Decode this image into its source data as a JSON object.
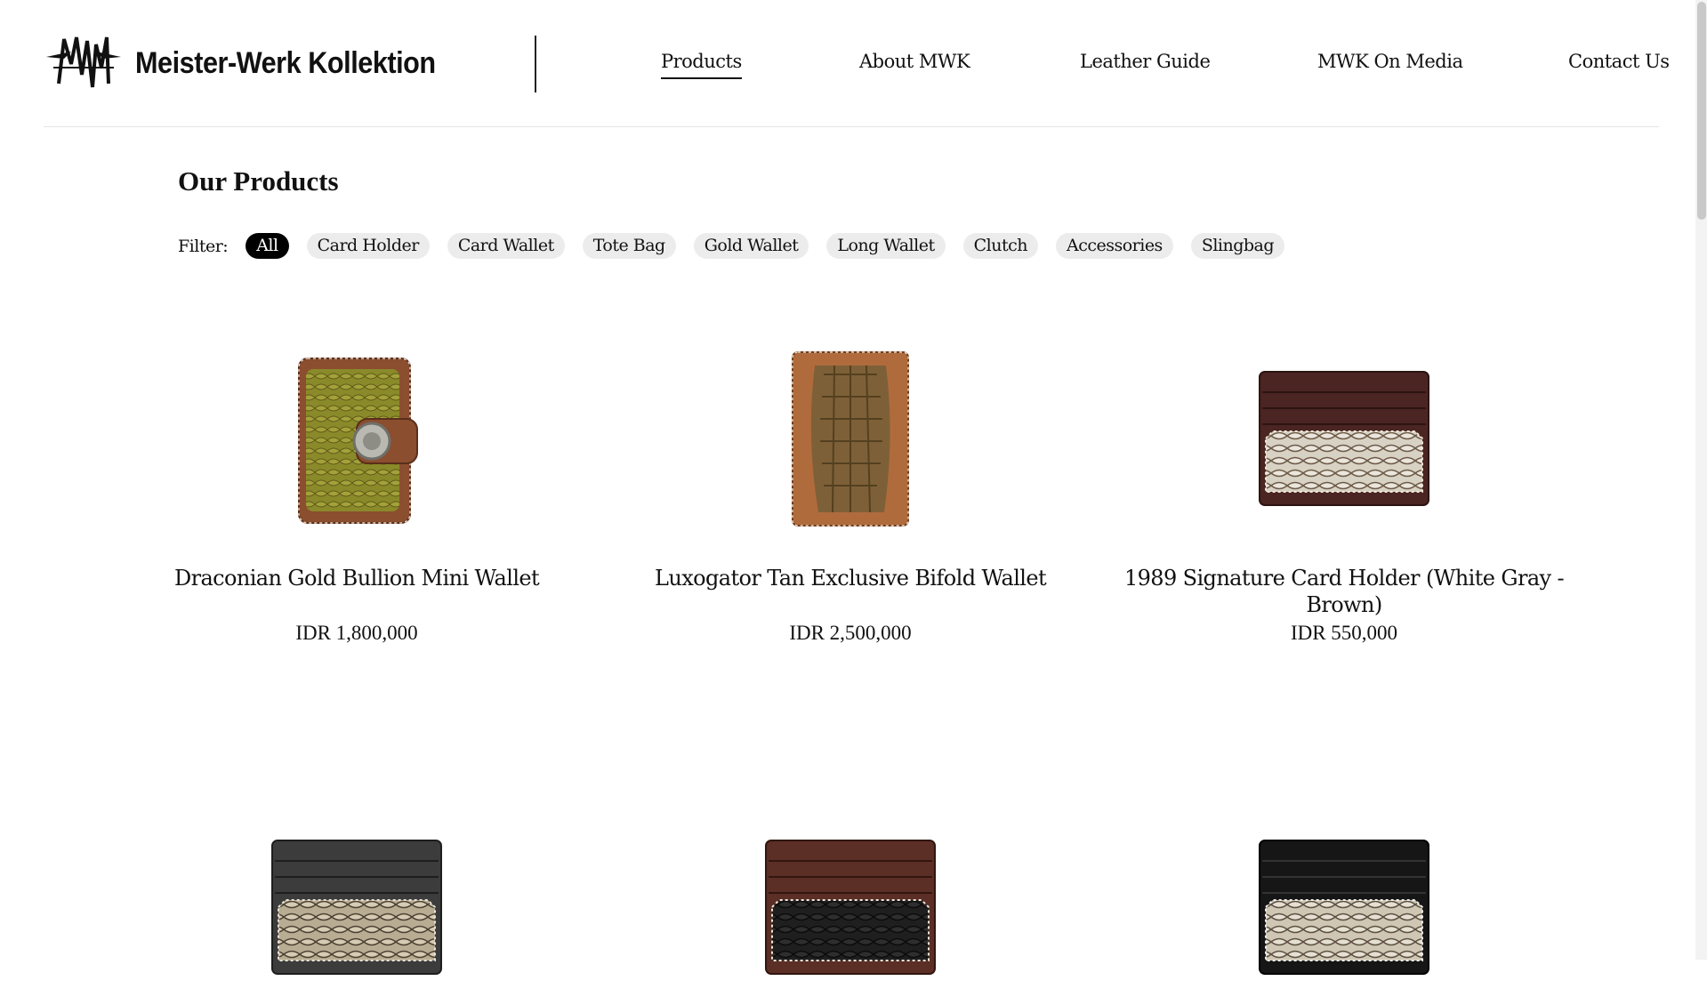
{
  "brand": {
    "name": "Meister-Werk Kollektion",
    "logo_text": "MWK"
  },
  "nav": {
    "items": [
      {
        "label": "Products",
        "active": true
      },
      {
        "label": "About MWK",
        "active": false
      },
      {
        "label": "Leather Guide",
        "active": false
      },
      {
        "label": "MWK On Media",
        "active": false
      },
      {
        "label": "Contact Us",
        "active": false
      }
    ]
  },
  "section": {
    "title": "Our Products"
  },
  "filter": {
    "label": "Filter:",
    "selected": "All",
    "chips": [
      "All",
      "Card Holder",
      "Card Wallet",
      "Tote Bag",
      "Gold Wallet",
      "Long Wallet",
      "Clutch",
      "Accessories",
      "Slingbag"
    ]
  },
  "products": [
    {
      "name": "Draconian Gold Bullion Mini Wallet",
      "price": "IDR 1,800,000",
      "image_icon": "python-mini-wallet-image"
    },
    {
      "name": "Luxogator Tan Exclusive Bifold Wallet",
      "price": "IDR 2,500,000",
      "image_icon": "crocodile-bifold-wallet-image"
    },
    {
      "name": "1989 Signature Card Holder (White Gray - Brown)",
      "price": "IDR 550,000",
      "image_icon": "python-card-holder-image"
    },
    {
      "name": "",
      "price": "",
      "image_icon": "black-python-card-holder-image"
    },
    {
      "name": "",
      "price": "",
      "image_icon": "brown-black-card-holder-image"
    },
    {
      "name": "",
      "price": "",
      "image_icon": "black-white-python-card-holder-image"
    }
  ],
  "colors": {
    "accent": "#000000",
    "chip_bg": "#ececec",
    "divider": "#e6e6e6"
  }
}
